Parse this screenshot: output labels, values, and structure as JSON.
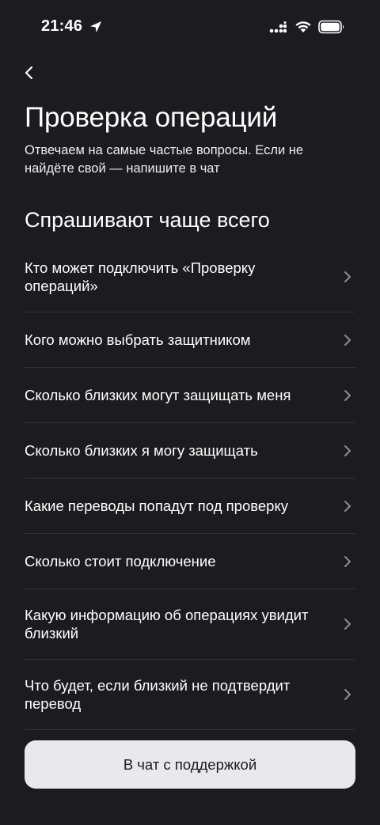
{
  "status_bar": {
    "time": "21:46",
    "icons": [
      "location-arrow-icon",
      "cellular-signal-icon",
      "wifi-icon",
      "battery-icon"
    ]
  },
  "header": {
    "back_icon": "chevron-left-icon",
    "title": "Проверка операций",
    "subtitle": "Отвечаем на самые частые вопросы. Если не найдёте свой — напишите в чат"
  },
  "faq": {
    "section_title": "Спрашивают чаще всего",
    "items": [
      {
        "label": "Кто может подключить «Проверку операций»"
      },
      {
        "label": "Кого можно выбрать защитником"
      },
      {
        "label": "Сколько близких могут защищать меня"
      },
      {
        "label": "Сколько близких я могу защищать"
      },
      {
        "label": "Какие переводы попадут под проверку"
      },
      {
        "label": "Сколько стоит подключение"
      },
      {
        "label": "Какую информацию об операциях увидит близкий"
      },
      {
        "label": "Что будет, если близкий не подтвердит перевод"
      }
    ]
  },
  "support_button": {
    "label": "В чат с поддержкой"
  },
  "colors": {
    "background": "#1c1b1f",
    "text": "#ffffff",
    "divider": "#333237",
    "button_bg": "#e9e8ec",
    "button_text": "#1c1b1f",
    "chevron": "#8e8d93"
  }
}
